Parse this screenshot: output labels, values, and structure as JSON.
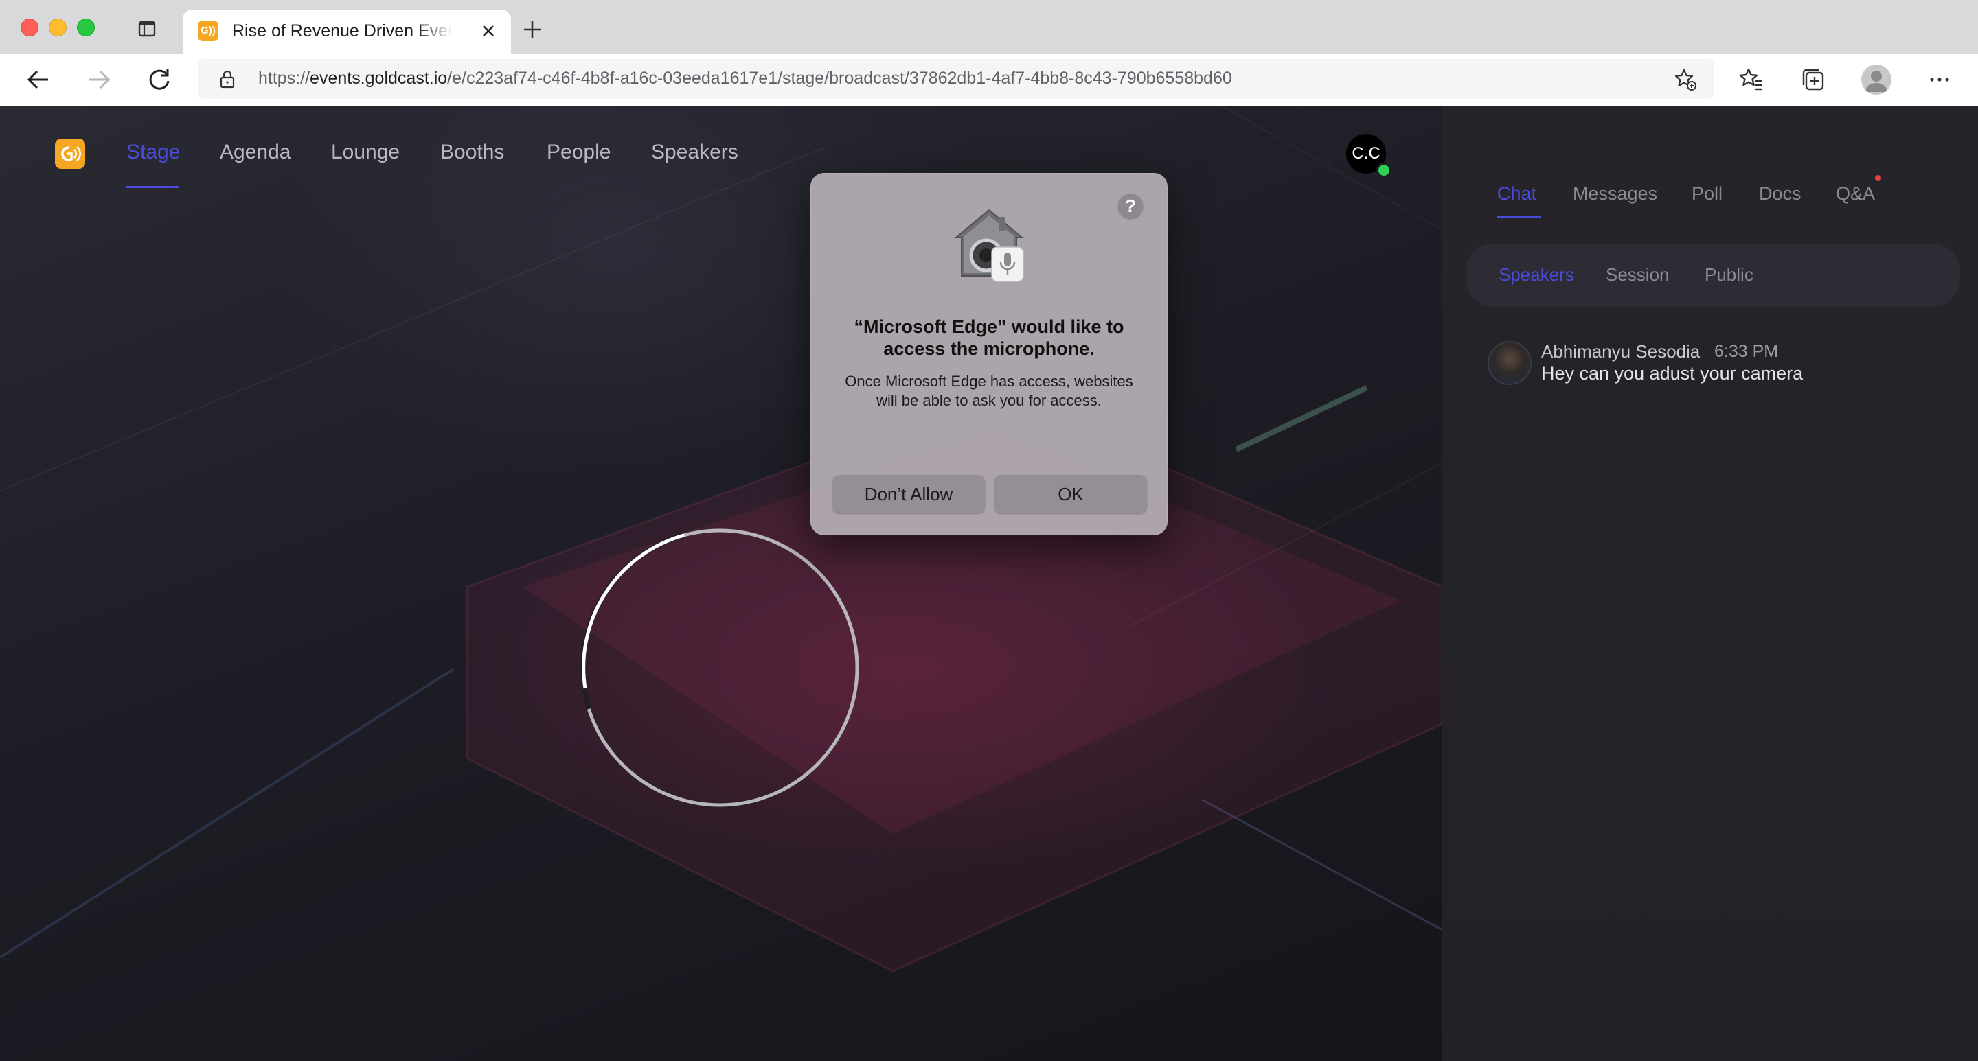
{
  "browser": {
    "tab": {
      "title": "Rise of Revenue Driven Event m",
      "favicon_text": "G))"
    },
    "url": {
      "prefix": "https://",
      "host": "events.goldcast.io",
      "path": "/e/c223af74-c46f-4b8f-a16c-03eeda1617e1/stage/broadcast/37862db1-4af7-4bb8-8c43-790b6558bd60"
    },
    "traffic_light_colors": [
      "#ff5f57",
      "#febc2e",
      "#28c840"
    ]
  },
  "app": {
    "accent_color": "#4a4cd8",
    "logo_color": "#f5a623",
    "nav": [
      {
        "label": "Stage",
        "active": true
      },
      {
        "label": "Agenda"
      },
      {
        "label": "Lounge"
      },
      {
        "label": "Booths"
      },
      {
        "label": "People"
      },
      {
        "label": "Speakers"
      }
    ],
    "user_initials": "C.C",
    "user_status": "online"
  },
  "sidebar": {
    "tabs": [
      {
        "label": "Chat",
        "active": true
      },
      {
        "label": "Messages"
      },
      {
        "label": "Poll"
      },
      {
        "label": "Docs"
      },
      {
        "label": "Q&A",
        "has_notification": true
      }
    ],
    "subtabs": [
      {
        "label": "Speakers",
        "active": true
      },
      {
        "label": "Session"
      },
      {
        "label": "Public"
      }
    ],
    "messages": [
      {
        "author": "Abhimanyu Sesodia",
        "time": "6:33 PM",
        "text": "Hey can you adust your camera"
      }
    ]
  },
  "dialog": {
    "title": "“Microsoft Edge” would like to access the microphone.",
    "body": "Once Microsoft Edge has access, websites will be able to ask you for access.",
    "help": "?",
    "deny_label": "Don’t Allow",
    "ok_label": "OK",
    "icon": "microphone-privacy-icon"
  },
  "stage": {
    "loading": true
  }
}
